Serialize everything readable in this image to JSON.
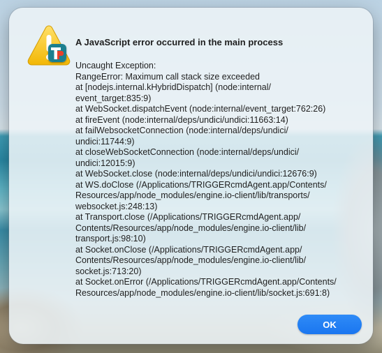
{
  "dialog": {
    "title": "A JavaScript error occurred in the main process",
    "message_lines": [
      "Uncaught Exception:",
      "RangeError: Maximum call stack size exceeded",
      "at [nodejs.internal.kHybridDispatch] (node:internal/",
      "event_target:835:9)",
      "at WebSocket.dispatchEvent (node:internal/event_target:762:26)",
      "at fireEvent (node:internal/deps/undici/undici:11663:14)",
      "at failWebsocketConnection (node:internal/deps/undici/",
      "undici:11744:9)",
      "at closeWebSocketConnection (node:internal/deps/undici/",
      "undici:12015:9)",
      "at WebSocket.close (node:internal/deps/undici/undici:12676:9)",
      "at WS.doClose (/Applications/TRIGGERcmdAgent.app/Contents/",
      "Resources/app/node_modules/engine.io-client/lib/transports/",
      "websocket.js:248:13)",
      "at Transport.close (/Applications/TRIGGERcmdAgent.app/",
      "Contents/Resources/app/node_modules/engine.io-client/lib/",
      "transport.js:98:10)",
      "at Socket.onClose (/Applications/TRIGGERcmdAgent.app/",
      "Contents/Resources/app/node_modules/engine.io-client/lib/",
      "socket.js:713:20)",
      "at Socket.onError (/Applications/TRIGGERcmdAgent.app/Contents/",
      "Resources/app/node_modules/engine.io-client/lib/socket.js:691:8)"
    ],
    "ok_label": "OK",
    "icon": "warning-triangle-icon",
    "badge_icon": "app-badge-icon",
    "colors": {
      "warning_yellow": "#f5c518",
      "badge_teal": "#1c7f8f",
      "badge_red": "#e8402a",
      "button_blue": "#1a76f0"
    }
  }
}
